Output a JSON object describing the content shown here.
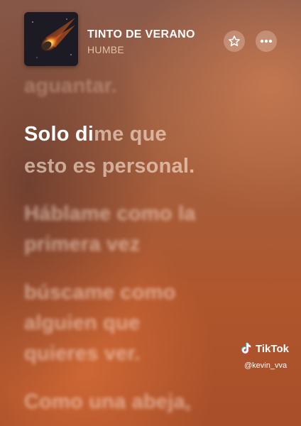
{
  "now_playing": {
    "title": "TINTO DE VERANO",
    "artist": "HUMBE"
  },
  "icons": {
    "artwork": "comet-artwork",
    "favorite": "star-icon",
    "more": "more-icon",
    "watermark": "tiktok-icon"
  },
  "lyrics": {
    "previous_line": "aguantar.",
    "active_line_1": {
      "word_1": "Solo ",
      "word_2_on": "d",
      "word_2_half": "i",
      "word_2_off": "me",
      "word_3": " que"
    },
    "active_line_2": "esto es personal.",
    "upcoming": [
      "Háblame como la",
      "primera vez",
      "búscame como",
      "alguien que",
      "quieres ver.",
      "Como una abeja,"
    ]
  },
  "watermark": {
    "brand": "TikTok",
    "handle": "@kevin_vva"
  }
}
